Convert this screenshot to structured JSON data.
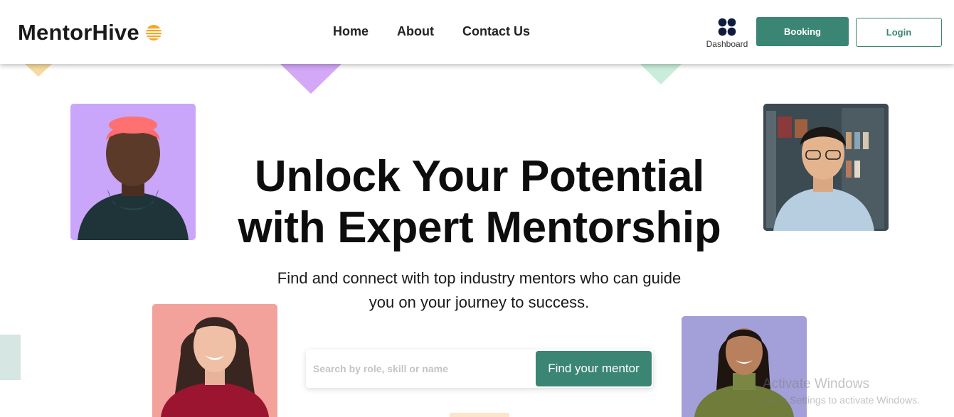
{
  "brand": {
    "name": "MentorHive",
    "icon": "stacked-lines-logo-icon",
    "icon_color": "#f5a623"
  },
  "nav": {
    "items": [
      {
        "label": "Home"
      },
      {
        "label": "About"
      },
      {
        "label": "Contact Us"
      }
    ]
  },
  "header_actions": {
    "dashboard_label": "Dashboard",
    "dashboard_icon": "four-dots-grid-icon",
    "booking_label": "Booking",
    "login_label": "Login"
  },
  "colors": {
    "accent": "#3b8574",
    "dark_navy": "#0f1a3d",
    "text": "#111111"
  },
  "hero": {
    "title_line1": "Unlock Your Potential",
    "title_line2": "with Expert Mentorship",
    "subtitle_line1": "Find and connect with top industry mentors who can guide",
    "subtitle_line2": "you on your journey to success."
  },
  "search": {
    "placeholder": "Search by role, skill or name",
    "value": "",
    "button_label": "Find your mentor"
  },
  "watermark": {
    "title": "Activate Windows",
    "subtitle": "Go to Settings to activate Windows."
  }
}
